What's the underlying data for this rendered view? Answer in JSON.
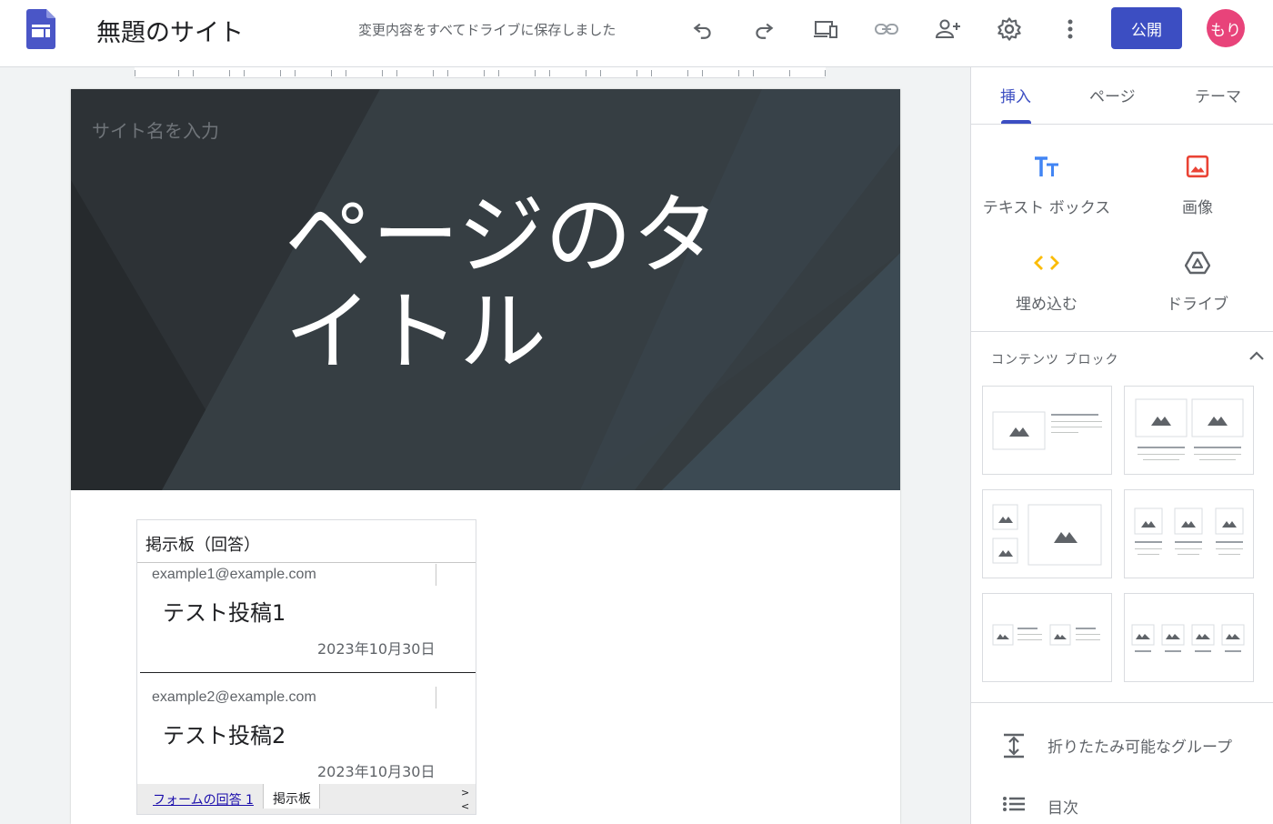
{
  "topbar": {
    "site_title": "無題のサイト",
    "save_status": "変更内容をすべてドライブに保存しました",
    "publish_label": "公開",
    "avatar_text": "もり",
    "icons": [
      "undo-icon",
      "redo-icon",
      "preview-icon",
      "link-icon",
      "share-icon",
      "settings-icon",
      "more-icon"
    ]
  },
  "page": {
    "site_name_placeholder": "サイト名を入力",
    "title": "ページのタイトル"
  },
  "sheet": {
    "title": "掲示板（回答）",
    "posts": [
      {
        "email": "example1@example.com",
        "title": "テスト投稿1",
        "date": "2023年10月30日"
      },
      {
        "email": "example2@example.com",
        "title": "テスト投稿2",
        "date": "2023年10月30日"
      }
    ],
    "tabs": [
      "フォームの回答 1",
      "掲示板"
    ],
    "nav_next": ">",
    "nav_prev": "<"
  },
  "panel": {
    "tabs": [
      "挿入",
      "ページ",
      "テーマ"
    ],
    "active_tab": "挿入",
    "insert_items": [
      {
        "label": "テキスト ボックス",
        "icon": "text-box-icon"
      },
      {
        "label": "画像",
        "icon": "image-icon"
      },
      {
        "label": "埋め込む",
        "icon": "embed-icon"
      },
      {
        "label": "ドライブ",
        "icon": "drive-icon"
      }
    ],
    "content_blocks_label": "コンテンツ ブロック",
    "collapsible_group_label": "折りたたみ可能なグループ",
    "toc_label": "目次"
  },
  "colors": {
    "accent": "#3c4ec2",
    "avatar": "#e8437a",
    "hero": "#353c40"
  }
}
